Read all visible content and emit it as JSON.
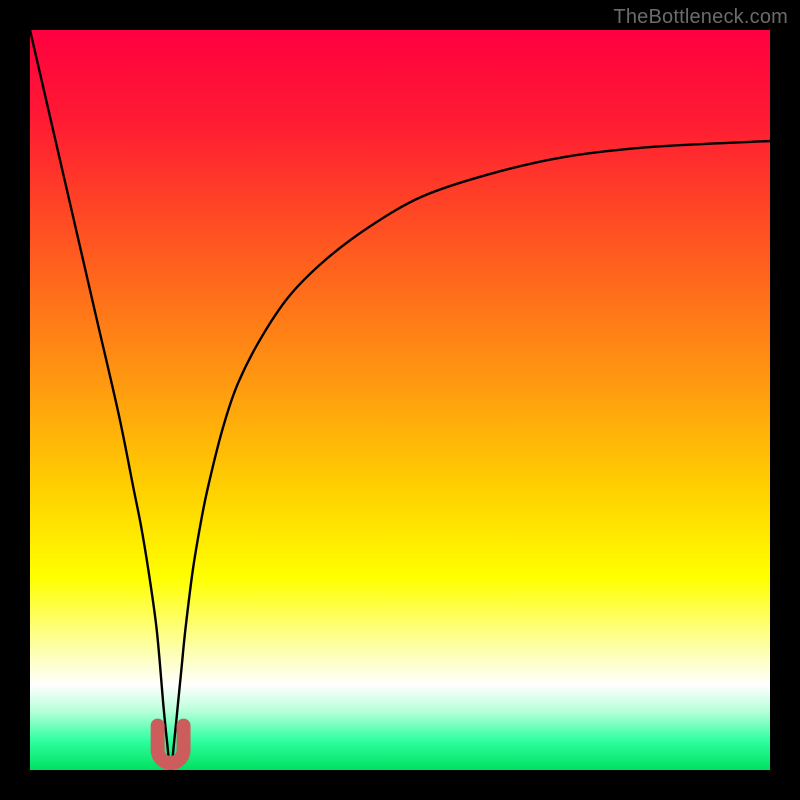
{
  "watermark": "TheBottleneck.com",
  "colors": {
    "frame": "#000000",
    "curve": "#000000",
    "marker_fill": "#cd5d5d",
    "marker_stroke": "#cd5d5d",
    "gradient_stops": [
      {
        "offset": 0.0,
        "color": "#ff0040"
      },
      {
        "offset": 0.12,
        "color": "#ff1a33"
      },
      {
        "offset": 0.3,
        "color": "#ff5a1f"
      },
      {
        "offset": 0.48,
        "color": "#ff9a10"
      },
      {
        "offset": 0.62,
        "color": "#ffd000"
      },
      {
        "offset": 0.74,
        "color": "#ffff00"
      },
      {
        "offset": 0.84,
        "color": "#fdffb0"
      },
      {
        "offset": 0.885,
        "color": "#ffffff"
      },
      {
        "offset": 0.92,
        "color": "#b8ffda"
      },
      {
        "offset": 0.96,
        "color": "#30ffa0"
      },
      {
        "offset": 1.0,
        "color": "#00e060"
      }
    ]
  },
  "chart_data": {
    "type": "line",
    "title": "",
    "xlabel": "",
    "ylabel": "",
    "xlim": [
      0,
      100
    ],
    "ylim": [
      0,
      100
    ],
    "notch_x": 19,
    "notch_value": 0,
    "right_end_value": 85,
    "series": [
      {
        "name": "bottleneck-curve",
        "x": [
          0,
          3,
          6,
          9,
          12,
          14,
          15,
          16,
          17,
          17.5,
          18,
          18.5,
          19,
          19.5,
          20,
          20.5,
          21,
          22,
          23,
          24,
          26,
          28,
          31,
          35,
          40,
          46,
          53,
          62,
          72,
          84,
          100
        ],
        "values": [
          100,
          87,
          74,
          61,
          48,
          38,
          33,
          27,
          20,
          15,
          9,
          4,
          0,
          4,
          9,
          14,
          19,
          27,
          33,
          38,
          46,
          52,
          58,
          64,
          69,
          73.5,
          77.5,
          80.5,
          82.8,
          84.2,
          85
        ]
      }
    ],
    "marker": {
      "shape": "u",
      "x": 19,
      "y": 0,
      "width_x": 3.5,
      "height_y": 6
    }
  }
}
